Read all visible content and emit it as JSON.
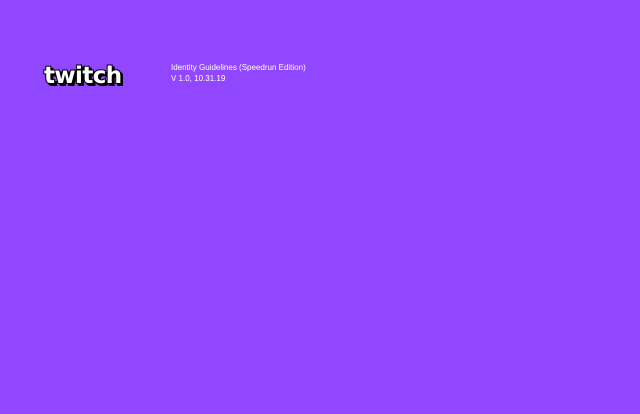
{
  "brand": {
    "logo_icon": "twitch-wordmark-logo",
    "logo_text": "twitch"
  },
  "document": {
    "title": "Identity Guidelines (Speedrun Edition)",
    "version": "V 1.0, 10.31.19"
  },
  "colors": {
    "background": "#9147ff",
    "text": "#ffffff",
    "logo_fill": "#ffffff",
    "logo_outline": "#000000"
  }
}
